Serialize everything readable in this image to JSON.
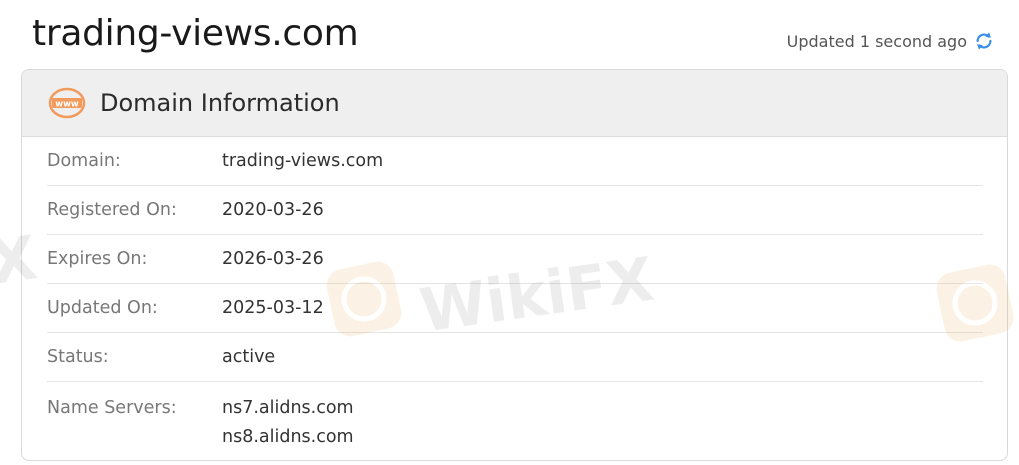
{
  "header": {
    "title": "trading-views.com",
    "updated_text": "Updated 1 second ago"
  },
  "card": {
    "title": "Domain Information",
    "icon_label": "www",
    "rows": [
      {
        "label": "Domain:",
        "value": "trading-views.com"
      },
      {
        "label": "Registered On:",
        "value": "2020-03-26"
      },
      {
        "label": "Expires On:",
        "value": "2026-03-26"
      },
      {
        "label": "Updated On:",
        "value": "2025-03-12"
      },
      {
        "label": "Status:",
        "value": "active"
      }
    ],
    "name_servers": {
      "label": "Name Servers:",
      "values": [
        "ns7.alidns.com",
        "ns8.alidns.com"
      ]
    }
  },
  "watermark": {
    "text": "WikiFX"
  },
  "colors": {
    "accent_orange": "#f29a5c",
    "refresh_blue": "#3a8ee6",
    "header_bg": "#efefef"
  },
  "icons": {
    "refresh": "refresh-icon",
    "www": "www-icon",
    "watermark_logo": "wikifx-logo-icon"
  }
}
